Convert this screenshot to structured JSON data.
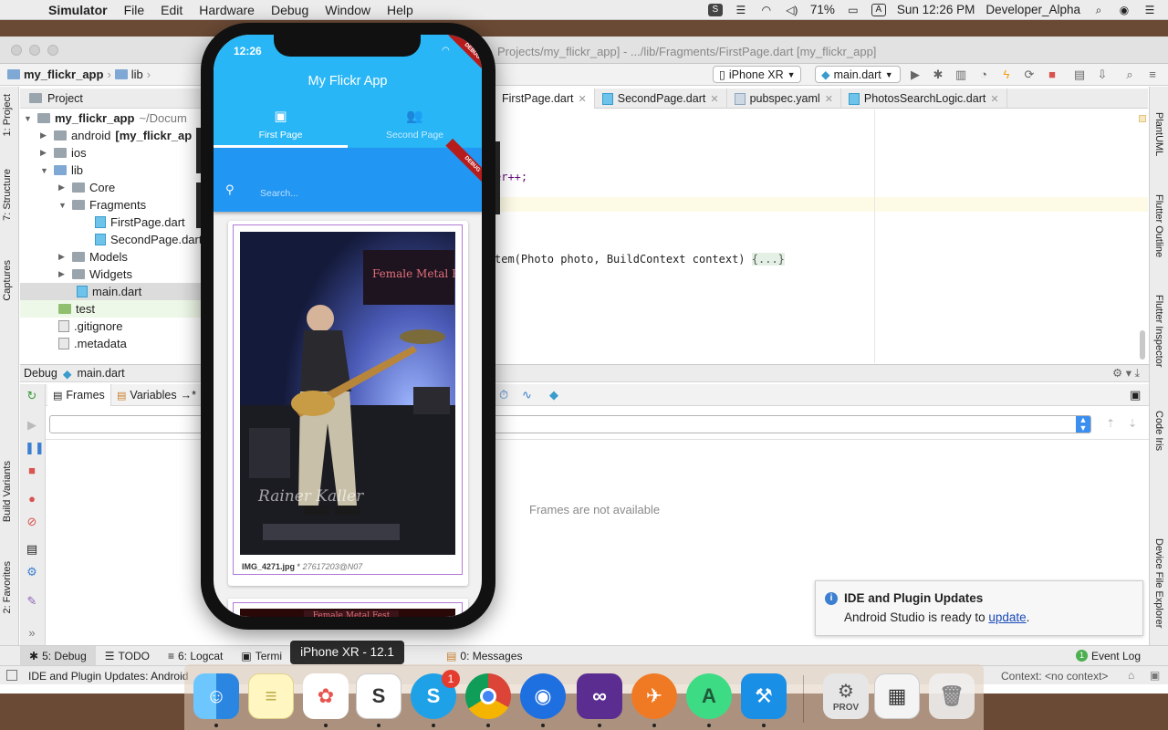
{
  "menubar": {
    "app_name": "Simulator",
    "menus": [
      "File",
      "Edit",
      "Hardware",
      "Debug",
      "Window",
      "Help"
    ],
    "battery": "71%",
    "input_source": "A",
    "clock": "Sun 12:26 PM",
    "user": "Developer_Alpha"
  },
  "window": {
    "title": "Projects/my_flickr_app] - .../lib/Fragments/FirstPage.dart [my_flickr_app]"
  },
  "navbar": {
    "crumbs": [
      "my_flickr_app",
      "lib"
    ],
    "device": "iPhone XR",
    "run_config": "main.dart"
  },
  "project_panel": {
    "header": "Project",
    "tree": [
      {
        "label": "my_flickr_app",
        "suffix": "~/Docum",
        "type": "folder-root"
      },
      {
        "label": "android",
        "suffix": "[my_flickr_ap",
        "type": "folder"
      },
      {
        "label": "ios",
        "type": "folder"
      },
      {
        "label": "lib",
        "type": "folder"
      },
      {
        "label": "Core",
        "type": "folder"
      },
      {
        "label": "Fragments",
        "type": "folder"
      },
      {
        "label": "FirstPage.dart",
        "type": "dart"
      },
      {
        "label": "SecondPage.dart",
        "type": "dart"
      },
      {
        "label": "Models",
        "type": "folder"
      },
      {
        "label": "Widgets",
        "type": "folder"
      },
      {
        "label": "main.dart",
        "type": "dart"
      },
      {
        "label": "test",
        "type": "folder"
      },
      {
        "label": ".gitignore",
        "type": "file"
      },
      {
        "label": ".metadata",
        "type": "file"
      }
    ]
  },
  "editor": {
    "tabs": [
      "FirstPage.dart",
      "SecondPage.dart",
      "pubspec.yaml",
      "PhotosSearchLogic.dart"
    ],
    "lines": {
      "l1": "er++;",
      "l2": "tem(Photo photo, BuildContext context) ",
      "l2_fold": "{...}"
    }
  },
  "debug_panel": {
    "title": "Debug",
    "config": "main.dart",
    "tabs": [
      "Frames",
      "Variables"
    ],
    "empty_message": "Frames are not available"
  },
  "notification": {
    "title": "IDE and Plugin Updates",
    "body_prefix": "Android Studio is ready to ",
    "link": "update",
    "body_suffix": "."
  },
  "left_strip": {
    "tabs": [
      "1: Project",
      "7: Structure",
      "Captures",
      "Build Variants",
      "2: Favorites"
    ]
  },
  "right_strip": {
    "tabs": [
      "PlantUML",
      "Flutter Outline",
      "Flutter Inspector",
      "Code Iris",
      "Device File Explorer"
    ]
  },
  "bottom_tabs": {
    "debug": "5: Debug",
    "todo": "TODO",
    "logcat": "6: Logcat",
    "terminal": "Termi",
    "messages": "0: Messages",
    "event_log": "Event Log",
    "event_count": "1"
  },
  "status_bar": {
    "message": "IDE and Plugin Updates: Android",
    "context": "Context: <no context>"
  },
  "tooltip": "iPhone XR - 12.1",
  "phone": {
    "time": "12:26",
    "app_title": "My Flickr App",
    "tabs": [
      "First Page",
      "Second Page"
    ],
    "search_placeholder": "Search...",
    "debug_banner": "DEBUG",
    "photo_sign": "Female Metal Fest",
    "photo_filename": "IMG_4271.jpg",
    "photo_separator": "*",
    "photo_owner": "27617203@N07",
    "photo_signature": "Rainer Kaller"
  },
  "dock": {
    "apps": [
      "Finder",
      "Notes",
      "Photos",
      "Slack",
      "Skype",
      "Chrome",
      "Proxyman",
      "Visual Studio",
      "Swift Playgrounds",
      "Android Studio",
      "Xcode",
      "System Preferences",
      "Keynote",
      "Trash"
    ],
    "skype_badge": "1",
    "prov_label": "PROV"
  },
  "colors": {
    "app_bar": "#29b6f6",
    "search_bar": "#2196f3",
    "debug_ribbon": "#b71c1c",
    "card_border": "#b37ad6",
    "link": "#1a4ab8"
  }
}
